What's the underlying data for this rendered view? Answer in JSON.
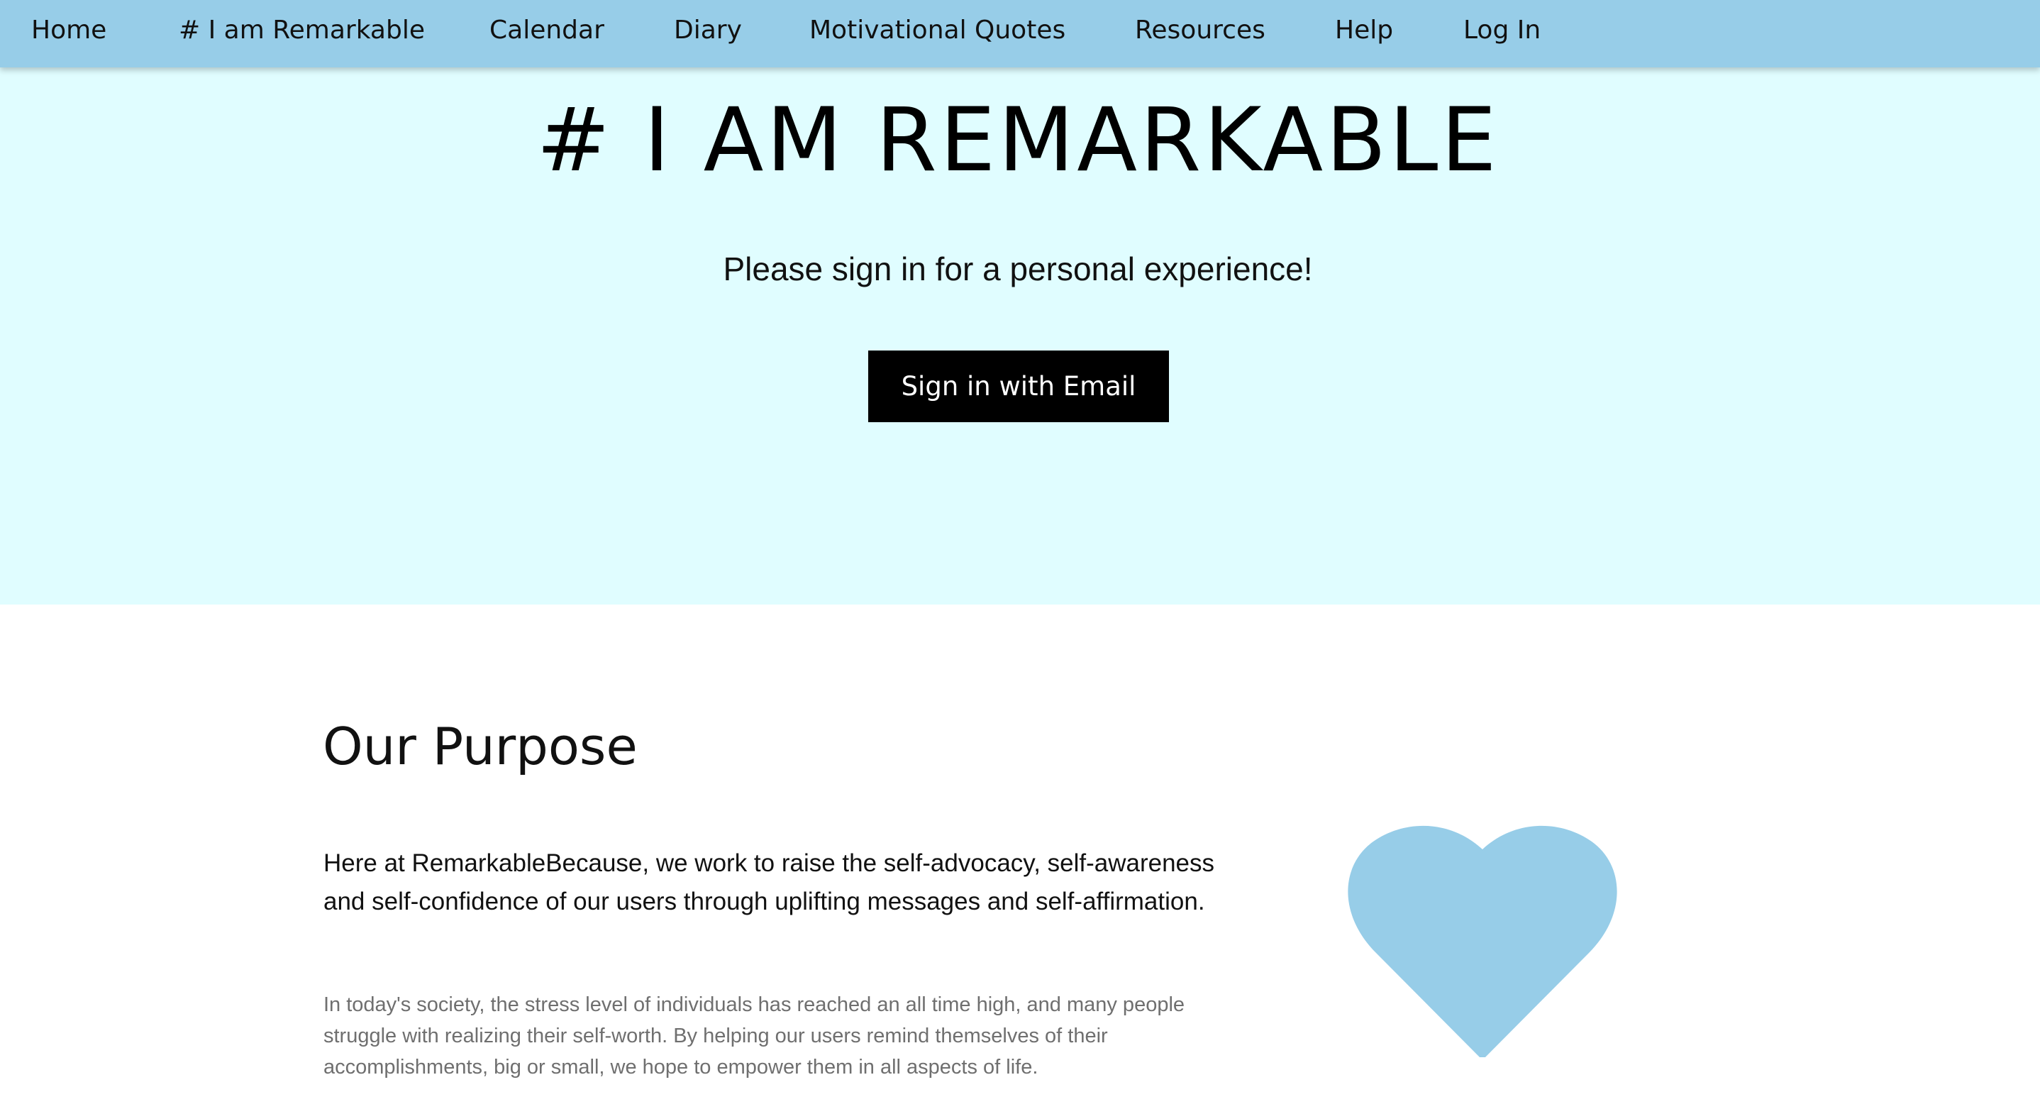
{
  "nav": {
    "items": [
      {
        "label": "Home"
      },
      {
        "label": "# I am Remarkable"
      },
      {
        "label": "Calendar"
      },
      {
        "label": "Diary"
      },
      {
        "label": "Motivational Quotes"
      },
      {
        "label": "Resources"
      },
      {
        "label": "Help"
      },
      {
        "label": "Log In"
      }
    ]
  },
  "hero": {
    "title": "# I AM REMARKABLE",
    "subtitle": "Please sign in for a personal experience!",
    "signin_label": "Sign in with Email"
  },
  "purpose": {
    "title": "Our Purpose",
    "lead": "Here at RemarkableBecause, we work to raise the self-advocacy, self-awareness and self-confidence of our users through uplifting messages and self-affirmation.",
    "body": "In today's society, the stress level of individuals has reached an all time high, and many people struggle with realizing their self-worth. By helping our users remind themselves of their accomplishments, big or small, we hope to empower them in all aspects of life."
  },
  "colors": {
    "nav_bg": "#97cde8",
    "hero_bg": "#e0fdff",
    "heart": "#97cde8",
    "button_bg": "#000000"
  },
  "icons": {
    "heart": "heart-icon"
  }
}
